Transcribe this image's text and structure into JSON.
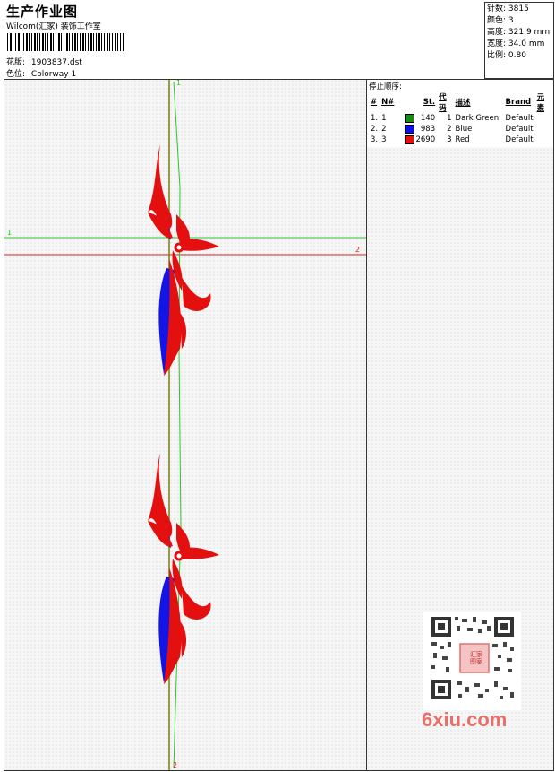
{
  "header": {
    "title": "生产作业图",
    "studio": "Wilcom(汇家) 装饰工作室",
    "design_label": "花版:",
    "design_value": "1903837.dst",
    "color_label": "色位:",
    "color_value": "Colorway 1"
  },
  "stats": [
    {
      "label": "针数:",
      "value": "3815"
    },
    {
      "label": "颜色:",
      "value": "3"
    },
    {
      "label": "高度:",
      "value": "321.9 mm"
    },
    {
      "label": "宽度:",
      "value": "34.0 mm"
    },
    {
      "label": "比例:",
      "value": "0.80"
    }
  ],
  "stop_sequence": {
    "title": "停止顺序:",
    "headers": [
      "#",
      "N#",
      "St.",
      "代码",
      "描述",
      "Brand",
      "元素"
    ],
    "rows": [
      {
        "idx": "1.",
        "n": "1",
        "st": "140",
        "code": "1",
        "desc": "Dark Green",
        "brand": "Default",
        "color": "#1a8a1a"
      },
      {
        "idx": "2.",
        "n": "2",
        "st": "983",
        "code": "2",
        "desc": "Blue",
        "brand": "Default",
        "color": "#1010e0"
      },
      {
        "idx": "3.",
        "n": "3",
        "st": "2690",
        "code": "3",
        "desc": "Red",
        "brand": "Default",
        "color": "#e41010"
      }
    ]
  },
  "markers": {
    "m1": "1",
    "m2": "2"
  },
  "watermark": "6xiu.com",
  "qr_stamp": "汇家 图案"
}
